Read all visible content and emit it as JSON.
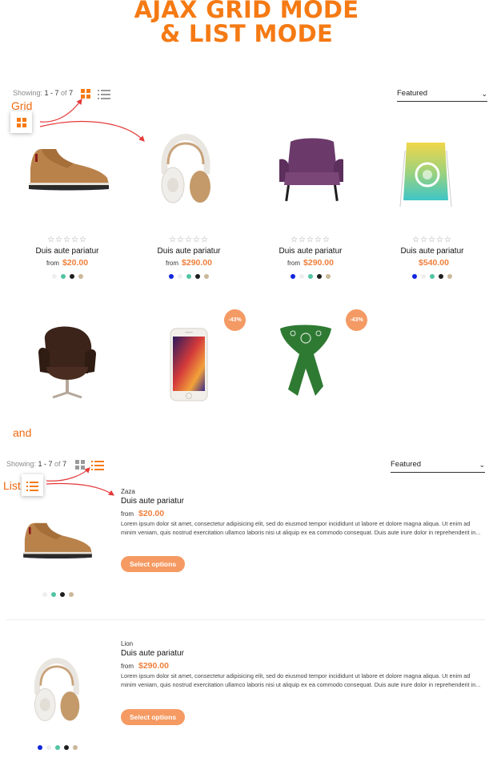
{
  "heading": {
    "line1": "AJAX GRID MODE",
    "line2": "& LIST MODE"
  },
  "grid_section": {
    "showing_prefix": "Showing: ",
    "showing_range": "1 - 7",
    "showing_of": " of ",
    "showing_total": "7",
    "sort_value": "Featured",
    "callout_label": "Grid",
    "products": [
      {
        "title": "Duis aute pariatur",
        "from": "from",
        "price": "$20.00",
        "swatches": [
          "#eeeeee",
          "#52c4a3",
          "#1f1f1f",
          "#cbb89a"
        ]
      },
      {
        "title": "Duis aute pariatur",
        "from": "from",
        "price": "$290.00",
        "swatches": [
          "#1226e0",
          "#eeeeee",
          "#52c4a3",
          "#1f1f1f",
          "#cbb89a"
        ]
      },
      {
        "title": "Duis aute pariatur",
        "from": "from",
        "price": "$290.00",
        "swatches": [
          "#1226e0",
          "#eeeeee",
          "#52c4a3",
          "#1f1f1f",
          "#cbb89a"
        ]
      },
      {
        "title": "Duis aute pariatur",
        "from": "",
        "price": "$540.00",
        "swatches": [
          "#1226e0",
          "#eeeeee",
          "#52c4a3",
          "#1f1f1f",
          "#cbb89a"
        ]
      }
    ],
    "row2_badges": [
      "-43%",
      "-43%"
    ]
  },
  "and_label": "and",
  "list_section": {
    "showing_prefix": "Showing: ",
    "showing_range": "1 - 7",
    "showing_of": " of ",
    "showing_total": "7",
    "sort_value": "Featured",
    "callout_label": "List",
    "items": [
      {
        "vendor": "Zaza",
        "title": "Duis aute pariatur",
        "from": "from",
        "price": "$20.00",
        "description": "Lorem ipsum dolor sit amet, consectetur adipisicing elit, sed do eiusmod tempor incididunt ut labore et dolore magna aliqua. Ut enim ad minim veniam, quis nostrud exercitation ullamco laboris nisi ut aliquip ex ea commodo consequat. Duis aute irure dolor in reprehenderit in...",
        "button": "Select options",
        "swatches": [
          "#eeeeee",
          "#52c4a3",
          "#1f1f1f",
          "#cbb89a"
        ]
      },
      {
        "vendor": "Lion",
        "title": "Duis aute pariatur",
        "from": "from",
        "price": "$290.00",
        "description": "Lorem ipsum dolor sit amet, consectetur adipisicing elit, sed do eiusmod tempor incididunt ut labore et dolore magna aliqua. Ut enim ad minim veniam, quis nostrud exercitation ullamco laboris nisi ut aliquip ex ea commodo consequat. Duis aute irure dolor in reprehenderit in...",
        "button": "Select options",
        "swatches": [
          "#1226e0",
          "#eeeeee",
          "#52c4a3",
          "#1f1f1f",
          "#cbb89a"
        ]
      }
    ]
  },
  "colors": {
    "accent": "#f57a14",
    "price": "#f07f3c",
    "button": "#f59a62",
    "icon_inactive": "#9a9a9a",
    "arrow": "#e53a3a"
  },
  "icons": {
    "grid": "grid-view-icon",
    "list": "list-view-icon",
    "chevron": "chevron-down-icon",
    "star": "star-outline-icon"
  }
}
